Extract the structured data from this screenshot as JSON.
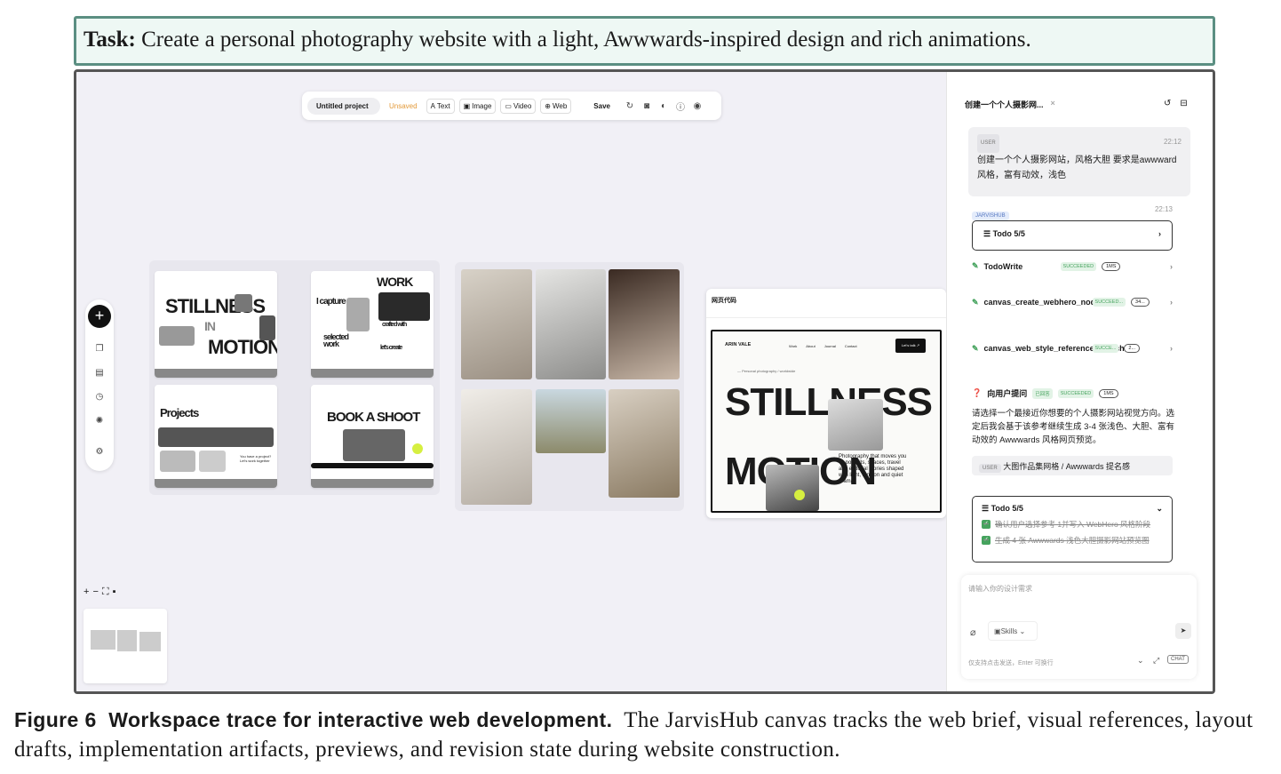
{
  "task": {
    "label": "Task:",
    "text": "Create a personal photography website with a light, Awwwards-inspired design and rich animations."
  },
  "toolbar": {
    "project": "Untitled project",
    "status": "Unsaved",
    "text": "Text",
    "image": "Image",
    "video": "Video",
    "web": "Web",
    "save": "Save"
  },
  "cards": {
    "stillness": "STILLNESS",
    "in": "IN",
    "motion": "MOTION",
    "icapture": "I capture",
    "work": "WORK",
    "selected": "selected work",
    "crafted": "crafted with",
    "create": "let's create",
    "projects": "Projects",
    "book": "BOOK A SHOOT",
    "project_q": "You have a project? Let's work together"
  },
  "preview": {
    "title": "网页代码",
    "stillness": "STILLNESS",
    "motion": "MOTION",
    "brand": "ARIN VALE",
    "nav": [
      "Work",
      "About",
      "Journal",
      "Contact"
    ],
    "cta": "Let's talk ↗",
    "tagline": "— Personal photography / worldwide",
    "desc": "Photography that moves you — portraits, spaces, travel and editorial stories shaped with light, tension and quiet drama."
  },
  "panel": {
    "title": "创建一个个人摄影网...",
    "user_tag": "USER",
    "user_time": "22:12",
    "user_text": "创建一个个人摄影网站，风格大胆 要求是awwward风格，富有动效，浅色",
    "jarvis_tag": "JARVISHUB",
    "jarvis_time": "22:13",
    "todo": "Todo 5/5",
    "tools": [
      {
        "name": "TodoWrite",
        "status": "SUCCEEDED",
        "time": "1MS"
      },
      {
        "name": "canvas_create_webhero_node",
        "status": "SUCCEED...",
        "time": "34..."
      },
      {
        "name": "canvas_web_style_reference_search",
        "status": "SUCCE...",
        "time": "2..."
      }
    ],
    "ask": {
      "name": "向用户提问",
      "answered": "已回答",
      "status": "SUCCEEDED",
      "time": "1MS"
    },
    "ask_text": "请选择一个最接近你想要的个人摄影网站视觉方向。选定后我会基于该参考继续生成 3-4 张浅色、大胆、富有动效的 Awwwards 风格网页预览。",
    "reply_tag": "USER",
    "reply": "大图作品集网格 / Awwwards 提名感",
    "todo_open": "Todo 5/5",
    "todo_items": [
      "确认用户选择参考 1并写入 WebHero 风格阶段",
      "生成 4 张 Awwwards 浅色大胆摄影网站预览图"
    ],
    "input_placeholder": "请输入你的设计需求",
    "skills": "Skills",
    "hint": "仅支持点击发送，Enter 可换行",
    "chat": "CHAT"
  },
  "caption": {
    "fig": "Figure 6",
    "title": "Workspace trace for interactive web development.",
    "text": "The JarvisHub canvas tracks the web brief, visual references, layout drafts, implementation artifacts, previews, and revision state during website construction."
  }
}
